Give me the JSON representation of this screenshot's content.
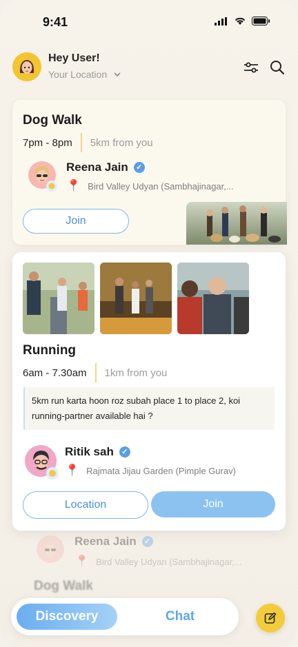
{
  "status_bar": {
    "time": "9:41"
  },
  "header": {
    "greeting": "Hey User!",
    "location": "Your Location",
    "accent": "#f2c531"
  },
  "cards": [
    {
      "title": "Dog Walk",
      "time": "7pm - 8pm",
      "distance": "5km from you",
      "host_name": "Reena Jain",
      "place": "Bird Valley Udyan (Sambhajinagar,...",
      "join_label": "Join"
    },
    {
      "title": "Running",
      "time": "6am - 7.30am",
      "distance": "1km from you",
      "description": "5km run karta hoon roz subah place 1 to place 2, koi running-partner available hai ?",
      "host_name": "Ritik sah",
      "place": "Rajmata Jijau Garden (Pimple Gurav)",
      "location_label": "Location",
      "join_label": "Join"
    }
  ],
  "faded_card": {
    "host_name": "Reena Jain",
    "place": "Bird Valley Udyan (Sambhajinagar,...",
    "title": "Dog Walk"
  },
  "nav": {
    "discovery": "Discovery",
    "chat": "Chat"
  },
  "colors": {
    "primary_blue": "#5ea6ea",
    "yellow": "#f2cc3b"
  }
}
